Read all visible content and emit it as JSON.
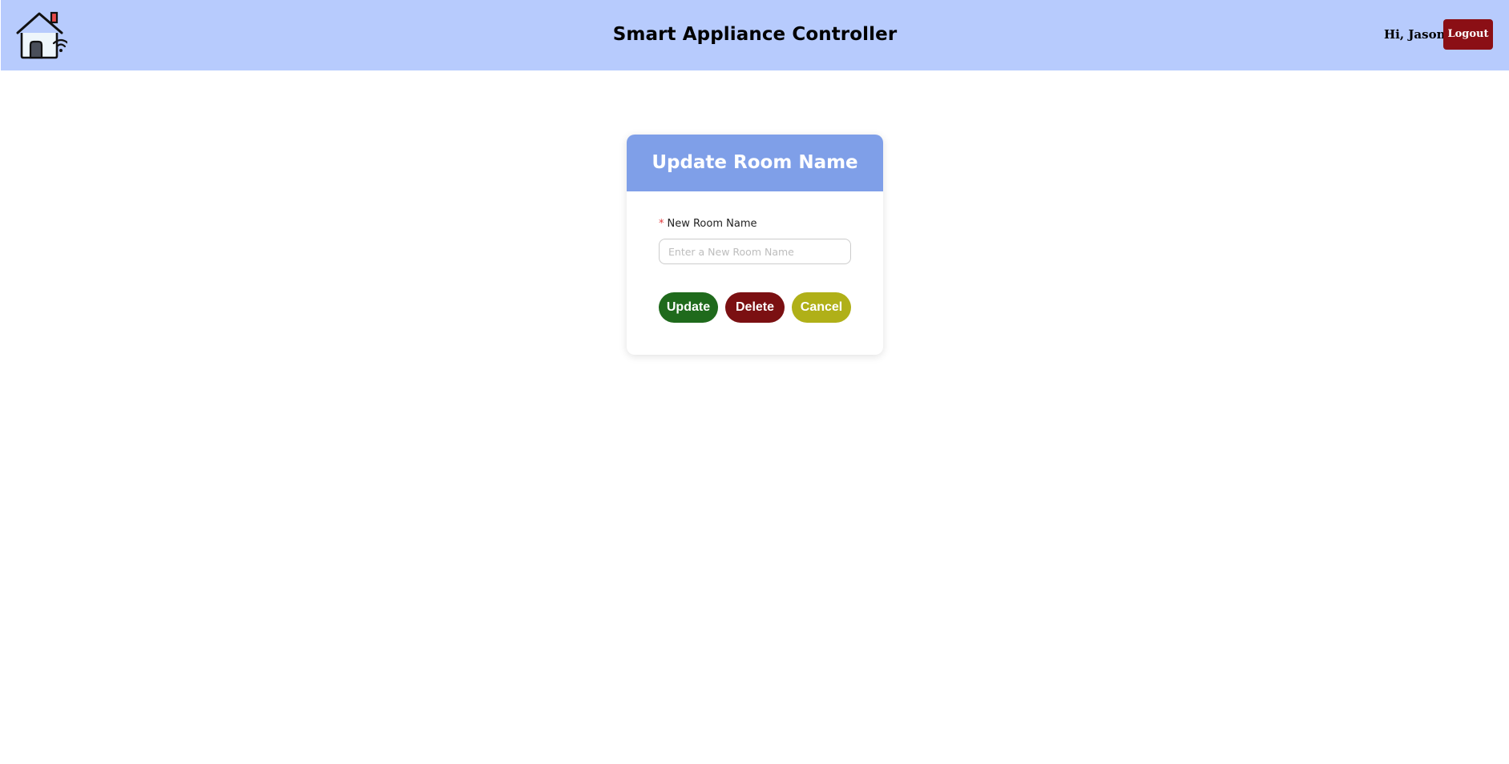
{
  "header": {
    "title": "Smart Appliance Controller",
    "greeting": "Hi, Jason",
    "logout_label": "Logout",
    "logo_icon": "smart-home-wifi-icon"
  },
  "card": {
    "title": "Update Room Name",
    "field": {
      "required_mark": "*",
      "label": "New Room Name",
      "value": "",
      "placeholder": "Enter a New Room Name"
    },
    "buttons": {
      "update_label": "Update",
      "delete_label": "Delete",
      "cancel_label": "Cancel"
    }
  },
  "colors": {
    "header_bg": "#b7cbfd",
    "card_header_bg": "#7f9fe8",
    "logout_bg": "#8b0f15",
    "update_bg": "#1f6a1c",
    "delete_bg": "#7b1012",
    "cancel_bg": "#b0b018",
    "required": "#e0383b"
  }
}
